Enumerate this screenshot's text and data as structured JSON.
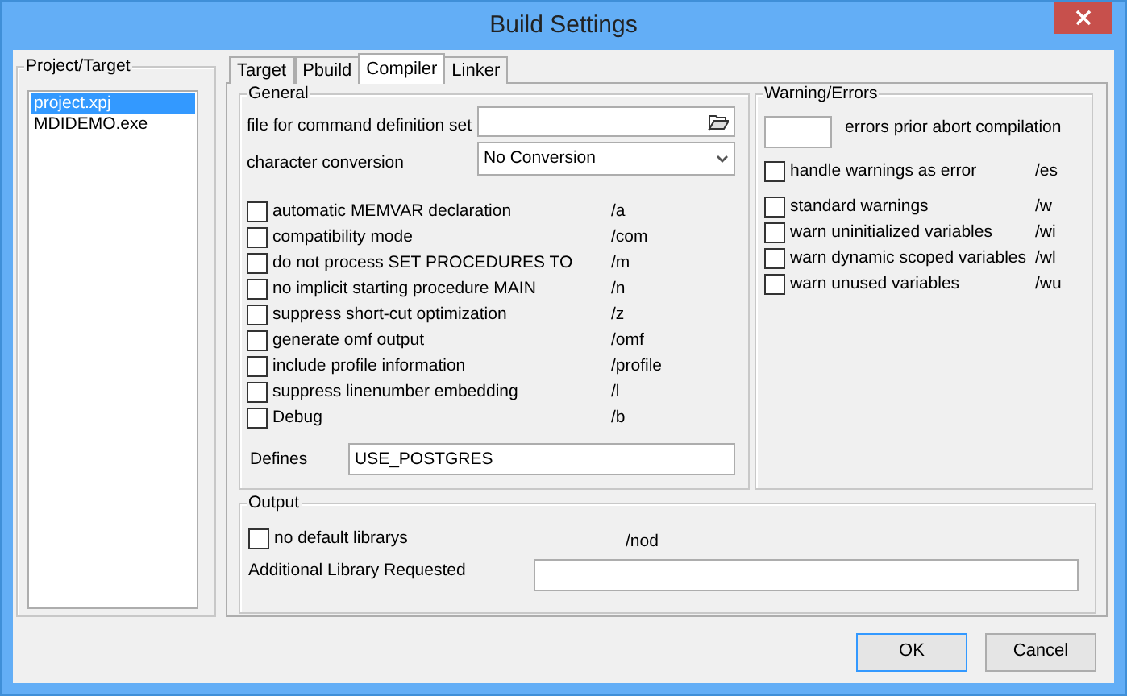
{
  "window": {
    "title": "Build Settings"
  },
  "project_target": {
    "label": "Project/Target",
    "items": [
      {
        "label": "project.xpj",
        "selected": true
      },
      {
        "label": "MDIDEMO.exe",
        "selected": false
      }
    ]
  },
  "tabs": [
    {
      "label": "Target",
      "selected": false
    },
    {
      "label": "Pbuild",
      "selected": false
    },
    {
      "label": "Compiler",
      "selected": true
    },
    {
      "label": "Linker",
      "selected": false
    }
  ],
  "general": {
    "label": "General",
    "command_file": {
      "label": "file for command definition set"
    },
    "char_conversion": {
      "label": "character conversion",
      "value": "No Conversion"
    },
    "options": [
      {
        "label": "automatic MEMVAR declaration",
        "switch": "/a",
        "checked": false
      },
      {
        "label": "compatibility mode",
        "switch": "/com",
        "checked": false
      },
      {
        "label": "do not process SET PROCEDURES TO",
        "switch": "/m",
        "checked": false
      },
      {
        "label": "no implicit starting procedure MAIN",
        "switch": "/n",
        "checked": false
      },
      {
        "label": "suppress short-cut optimization",
        "switch": "/z",
        "checked": false
      },
      {
        "label": "generate omf output",
        "switch": "/omf",
        "checked": false
      },
      {
        "label": "include profile information",
        "switch": "/profile",
        "checked": false
      },
      {
        "label": "suppress linenumber embedding",
        "switch": "/l",
        "checked": false
      },
      {
        "label": "Debug",
        "switch": "/b",
        "checked": false
      }
    ],
    "defines": {
      "label": "Defines",
      "value": "USE_POSTGRES"
    }
  },
  "warnings": {
    "label": "Warning/Errors",
    "errors_prior": {
      "label": "errors prior abort compilation"
    },
    "options": [
      {
        "label": "handle warnings as error",
        "switch": "/es",
        "checked": false
      },
      {
        "label": "standard warnings",
        "switch": "/w",
        "checked": false
      },
      {
        "label": "warn uninitialized variables",
        "switch": "/wi",
        "checked": false
      },
      {
        "label": "warn dynamic scoped variables",
        "switch": "/wl",
        "checked": false
      },
      {
        "label": "warn unused variables",
        "switch": "/wu",
        "checked": false
      }
    ]
  },
  "output": {
    "label": "Output",
    "option": {
      "label": "no default librarys",
      "switch": "/nod",
      "checked": false
    },
    "additional": {
      "label": "Additional Library Requested"
    }
  },
  "buttons": [
    {
      "label": "OK",
      "default": true
    },
    {
      "label": "Cancel",
      "default": false
    }
  ]
}
